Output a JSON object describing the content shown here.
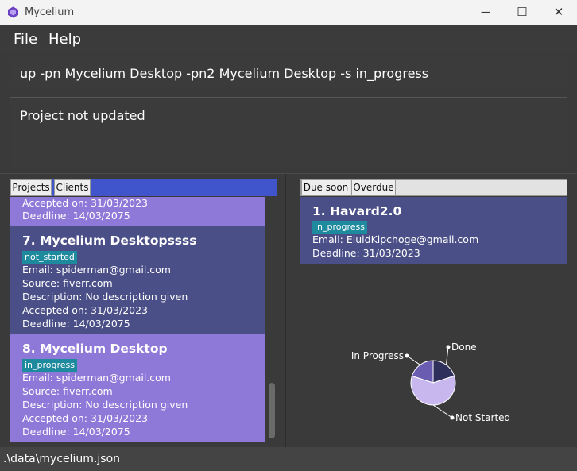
{
  "window": {
    "title": "Mycelium",
    "controls": [
      "minimize-icon",
      "maximize-icon",
      "close-icon"
    ]
  },
  "menu": {
    "file": "File",
    "help": "Help"
  },
  "command": {
    "value": "up -pn Mycelium Desktop -pn2 Mycelium Desktop -s in_progress"
  },
  "result": {
    "text": "Project not updated"
  },
  "left_tabs": {
    "projects": "Projects",
    "clients": "Clients"
  },
  "projects": {
    "partial": {
      "accepted": "Accepted on: 31/03/2023",
      "deadline": "Deadline: 14/03/2075"
    },
    "p7": {
      "title": "7.  Mycelium Desktopssss",
      "status": "not_started",
      "email": "Email: spiderman@gmail.com",
      "source": "Source: fiverr.com",
      "description": "Description: No description given",
      "accepted": "Accepted on: 31/03/2023",
      "deadline": "Deadline: 14/03/2075"
    },
    "p8": {
      "title": "8.  Mycelium Desktop",
      "status": "in_progress",
      "email": "Email: spiderman@gmail.com",
      "source": "Source: fiverr.com",
      "description": "Description: No description given",
      "accepted": "Accepted on: 31/03/2023",
      "deadline": "Deadline: 14/03/2075"
    }
  },
  "right_tabs": {
    "due_soon": "Due soon",
    "overdue": "Overdue"
  },
  "due_soon": {
    "title": "1.  Havard2.0",
    "status": "in_progress",
    "email": "Email: EluidKipchoge@gmail.com",
    "deadline": "Deadline: 31/03/2023"
  },
  "chart_data": {
    "type": "pie",
    "labels": [
      "Not Started",
      "In Progress",
      "Done"
    ],
    "values": [
      3,
      1,
      1
    ],
    "colors": [
      "#c8b6ee",
      "#6a5cb0",
      "#2e2f5a"
    ],
    "legend": "callout-labels"
  },
  "status": {
    "path": ".\\data\\mycelium.json"
  },
  "colors": {
    "accent_tab_bar": "#4055cc",
    "card_light": "#8f79d8",
    "card_dark": "#4b4f88",
    "tag": "#1e8a9e",
    "background": "#3a3a3a"
  }
}
